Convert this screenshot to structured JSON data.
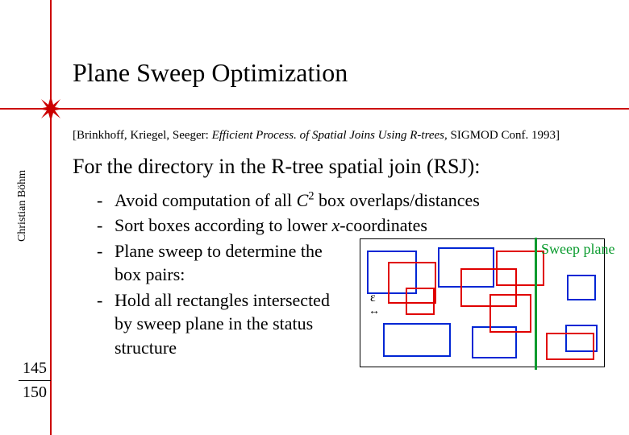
{
  "title": "Plane Sweep Optimization",
  "citation": {
    "prefix": "[Brinkhoff, Kriegel, Seeger: ",
    "italic": "Efficient Process. of Spatial Joins Using R-trees",
    "suffix": ", SIGMOD Conf. 1993]"
  },
  "subhead": "For the directory in the R-tree spatial join (RSJ):",
  "bullets": {
    "b1_pre": "Avoid computation of all ",
    "b1_var": "C",
    "b1_sup": "2",
    "b1_post": " box overlaps/distances",
    "b2_pre": "Sort boxes according to lower ",
    "b2_var": "x",
    "b2_post": "-coordinates",
    "b3": "Plane sweep to determine the box pairs:",
    "b4": "Hold all rectangles inter­sected by sweep plane in the status structure"
  },
  "author": "Christian Böhm",
  "page": {
    "current": "145",
    "total": "150"
  },
  "diagram": {
    "sweep_label": "Sweep plane",
    "epsilon": "ε"
  },
  "colors": {
    "rule": "#c00",
    "sweep": "#0a9b2e",
    "blue": "#0026d4",
    "red": "#e00000"
  }
}
